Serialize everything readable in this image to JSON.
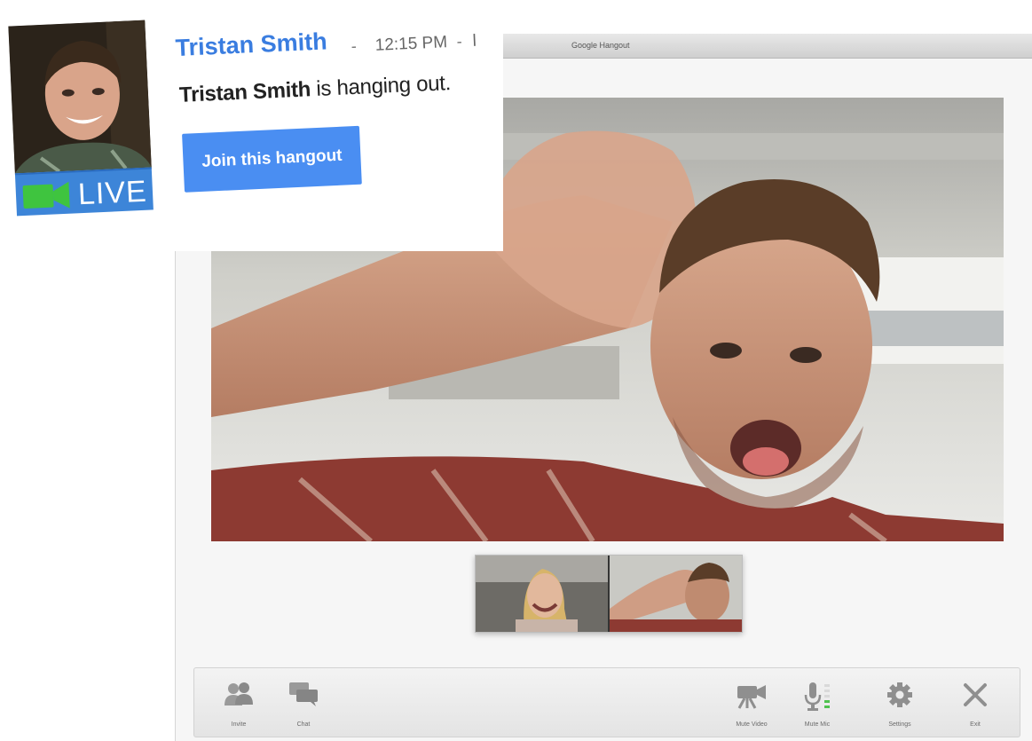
{
  "window": {
    "title": "Google Hangout"
  },
  "notification": {
    "name": "Tristan Smith",
    "separator": "-",
    "time": "12:15 PM",
    "truncated": "l",
    "status_name": "Tristan Smith",
    "status_rest": " is hanging out.",
    "join_label": "Join this hangout",
    "live_label": "LIVE",
    "live_color": "#3d85d8",
    "accent_color": "#4a8ef2"
  },
  "toolbar": {
    "invite_label": "Invite",
    "chat_label": "Chat",
    "mute_video_label": "Mute Video",
    "mute_mic_label": "Mute Mic",
    "settings_label": "Settings",
    "exit_label": "Exit"
  },
  "icons": [
    "people-icon",
    "chat-icon",
    "video-camera-icon",
    "microphone-icon",
    "gear-icon",
    "close-icon",
    "video-camera-icon"
  ]
}
